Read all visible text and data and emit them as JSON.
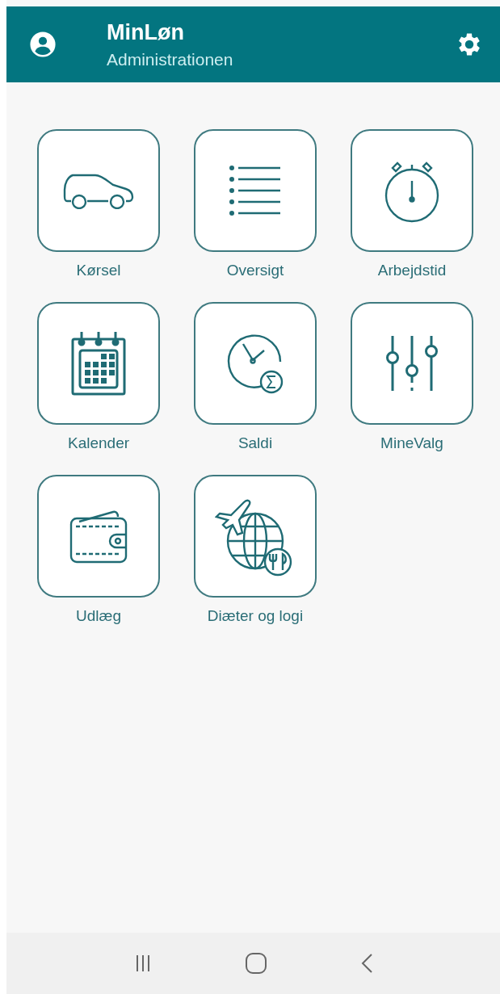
{
  "app_bar": {
    "title": "MinLøn",
    "subtitle": "Administrationen"
  },
  "tiles": [
    {
      "kind": "car",
      "label": "Kørsel"
    },
    {
      "kind": "list",
      "label": "Oversigt"
    },
    {
      "kind": "stopwatch",
      "label": "Arbejdstid"
    },
    {
      "kind": "calendar",
      "label": "Kalender"
    },
    {
      "kind": "clocksum",
      "label": "Saldi"
    },
    {
      "kind": "sliders",
      "label": "MineValg"
    },
    {
      "kind": "wallet",
      "label": "Udlæg"
    },
    {
      "kind": "travel",
      "label": "Diæter og logi"
    }
  ]
}
